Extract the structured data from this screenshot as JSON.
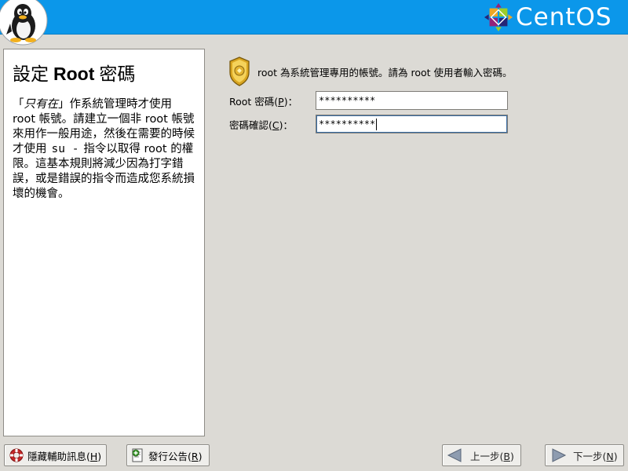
{
  "banner": {
    "brand_name": "CentOS",
    "colors": {
      "banner": "#0b97ea",
      "brand_text": "#ffffff"
    },
    "icons": [
      "tux-penguin-icon",
      "centos-mark-icon"
    ]
  },
  "help": {
    "title_pre": "設定",
    "title_bold": "Root",
    "title_post": "密碼",
    "p_open": "「",
    "p_italic": "只有在",
    "p_1": "」作系統管理時才使用 root 帳號。請建立一個非",
    "p_root": "root",
    "p_2": "帳號來用作一般用途，然後在需要的時候才使用",
    "p_cmd": "su -",
    "p_3": "指令以取得 root 的權限。這基本規則將減少因為打字錯誤，或是錯誤的指令而造成您系統損壞的機會。"
  },
  "main": {
    "intro": "root 為系統管理專用的帳號。請為  root 使用者輸入密碼。",
    "password_label": "Root 密碼(",
    "password_key": "P",
    "password_label_end": ")：",
    "password_value": "**********",
    "confirm_label": "密碼確認(",
    "confirm_key": "C",
    "confirm_label_end": ")：",
    "confirm_value": "**********"
  },
  "buttons": {
    "hide_help": {
      "label": "隱藏輔助訊息(",
      "key": "H",
      "end": ")"
    },
    "release_notes": {
      "label": "發行公告(",
      "key": "R",
      "end": ")"
    },
    "back": {
      "label": "上一步(",
      "key": "B",
      "end": ")"
    },
    "next": {
      "label": "下一步(",
      "key": "N",
      "end": ")"
    }
  }
}
